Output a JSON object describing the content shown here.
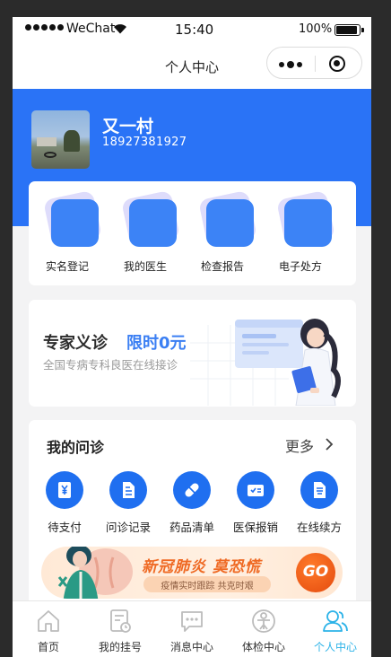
{
  "status_bar": {
    "carrier": "WeChat",
    "time": "15:40",
    "battery": "100%"
  },
  "nav": {
    "title": "个人中心",
    "menu_icon": "more-dots-icon",
    "close_icon": "target-icon"
  },
  "user": {
    "name": "又一村",
    "phone": "18927381927"
  },
  "quick_actions": [
    {
      "label": "实名登记",
      "icon": "square-tile-icon"
    },
    {
      "label": "我的医生",
      "icon": "square-tile-icon"
    },
    {
      "label": "检查报告",
      "icon": "square-tile-icon"
    },
    {
      "label": "电子处方",
      "icon": "square-tile-icon"
    }
  ],
  "banner": {
    "title": "专家义诊",
    "highlight": "限时0元",
    "subtitle": "全国专病专科良医在线接诊"
  },
  "consult": {
    "heading": "我的问诊",
    "more": "更多",
    "services": [
      {
        "label": "待支付",
        "icon": "yen-document-icon"
      },
      {
        "label": "问诊记录",
        "icon": "record-document-icon"
      },
      {
        "label": "药品清单",
        "icon": "pill-icon"
      },
      {
        "label": "医保报销",
        "icon": "insurance-card-icon"
      },
      {
        "label": "在线续方",
        "icon": "renew-document-icon"
      }
    ],
    "promo": {
      "title": "新冠肺炎 莫恐慌",
      "subtitle": "疫情实时跟踪 共克时艰",
      "go": "GO"
    }
  },
  "tabs": [
    {
      "label": "首页",
      "icon": "home-icon",
      "active": false
    },
    {
      "label": "我的挂号",
      "icon": "registration-icon",
      "active": false
    },
    {
      "label": "消息中心",
      "icon": "message-icon",
      "active": false
    },
    {
      "label": "体检中心",
      "icon": "checkup-icon",
      "active": false
    },
    {
      "label": "个人中心",
      "icon": "profile-icon",
      "active": true
    }
  ],
  "colors": {
    "primary": "#2a73f6",
    "tile": "#3c83f6",
    "accent_tab": "#2db3e8",
    "promo_orange": "#ef6a24"
  }
}
